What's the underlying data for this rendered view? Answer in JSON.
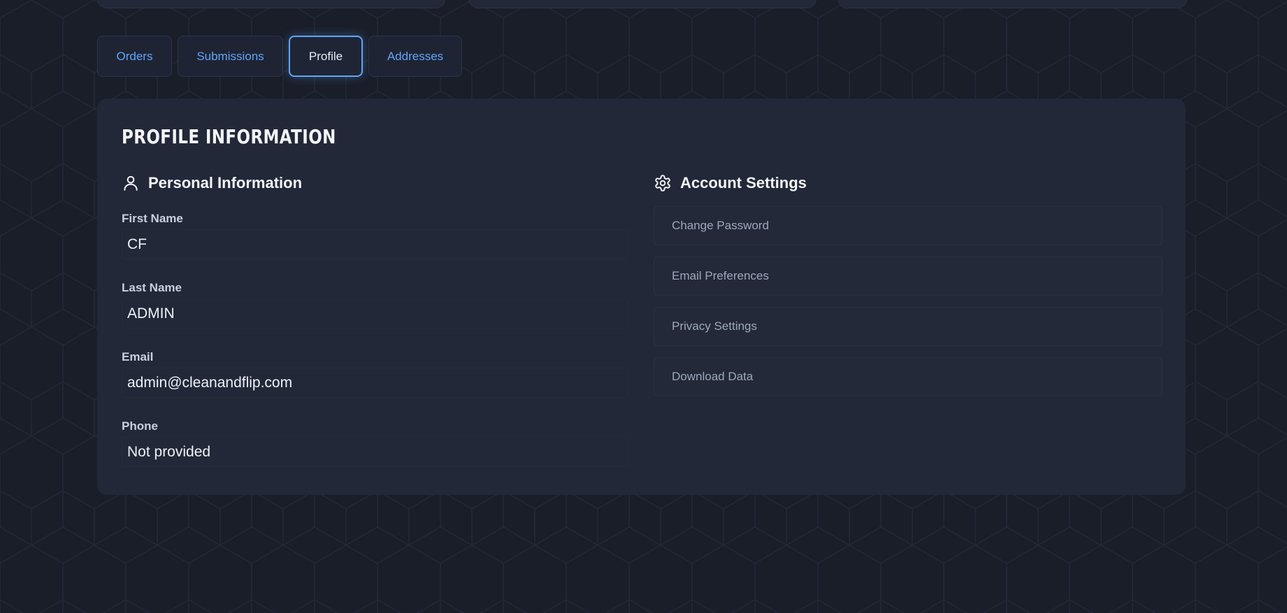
{
  "tabs": [
    {
      "label": "Orders",
      "active": false
    },
    {
      "label": "Submissions",
      "active": false
    },
    {
      "label": "Profile",
      "active": true
    },
    {
      "label": "Addresses",
      "active": false
    }
  ],
  "profile": {
    "title": "Profile Information",
    "personal": {
      "heading": "Personal Information",
      "icon": "user-icon",
      "fields": [
        {
          "label": "First Name",
          "value": "CF"
        },
        {
          "label": "Last Name",
          "value": "ADMIN"
        },
        {
          "label": "Email",
          "value": "admin@cleanandflip.com"
        },
        {
          "label": "Phone",
          "value": "Not provided"
        }
      ]
    },
    "settings": {
      "heading": "Account Settings",
      "icon": "gear-icon",
      "actions": [
        {
          "label": "Change Password"
        },
        {
          "label": "Email Preferences"
        },
        {
          "label": "Privacy Settings"
        },
        {
          "label": "Download Data"
        }
      ]
    }
  },
  "colors": {
    "background": "#1a1e29",
    "panel": "#222838",
    "accent": "#60a5fa"
  }
}
